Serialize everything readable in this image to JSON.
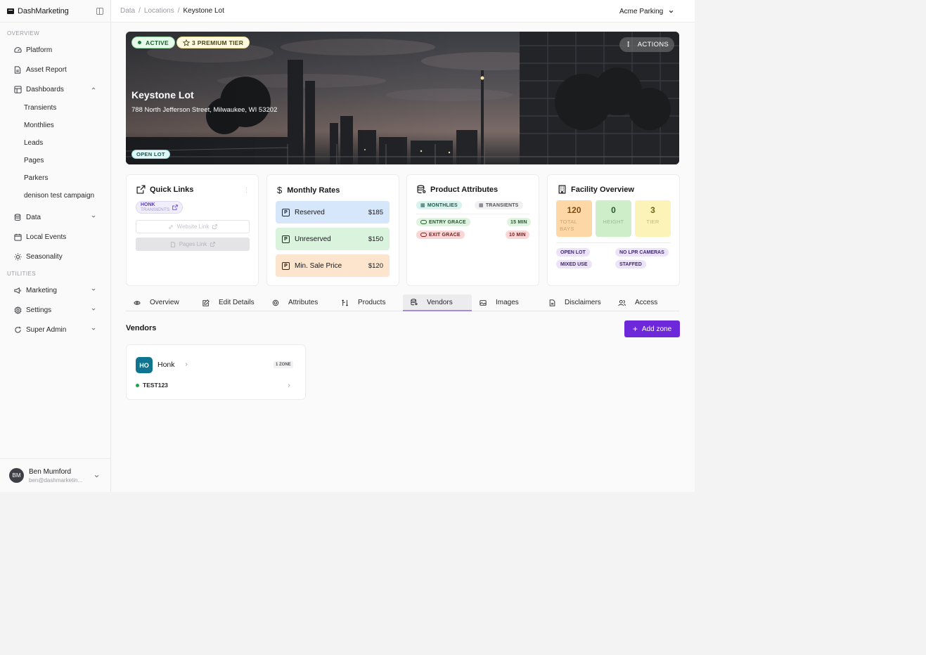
{
  "brand": {
    "name": "DashMarketing"
  },
  "sidebar": {
    "overview_label": "OVERVIEW",
    "utilities_label": "UTILITIES",
    "items": [
      {
        "label": "Platform",
        "icon": "gauge-icon"
      },
      {
        "label": "Asset Report",
        "icon": "file-icon"
      },
      {
        "label": "Dashboards",
        "icon": "layout-icon"
      }
    ],
    "dashboards": [
      "Transients",
      "Monthlies",
      "Leads",
      "Pages",
      "Parkers",
      "denison test campaign"
    ],
    "items2": [
      {
        "label": "Data",
        "icon": "database-icon"
      },
      {
        "label": "Local Events",
        "icon": "calendar-icon"
      },
      {
        "label": "Seasonality",
        "icon": "sun-icon"
      }
    ],
    "utilities": [
      {
        "label": "Marketing",
        "icon": "megaphone-icon"
      },
      {
        "label": "Settings",
        "icon": "gear-icon"
      },
      {
        "label": "Super Admin",
        "icon": "refresh-icon"
      }
    ]
  },
  "user": {
    "initials": "BM",
    "name": "Ben Mumford",
    "email": "ben@dashmarketin..."
  },
  "header": {
    "breadcrumb": [
      "Data",
      "Locations",
      "Keystone Lot"
    ],
    "org": "Acme Parking"
  },
  "hero": {
    "status": "ACTIVE",
    "tier": "3 PREMIUM TIER",
    "actions": "ACTIONS",
    "title": "Keystone Lot",
    "address": "788 North Jefferson Street, Milwaukee, WI 53202",
    "lot_type": "OPEN LOT"
  },
  "quick_links": {
    "title": "Quick Links",
    "chip_name": "HONK",
    "chip_sub": "TRANSIENTS",
    "website": "Website Link",
    "pages": "Pages Link"
  },
  "monthly_rates": {
    "title": "Monthly Rates",
    "rows": [
      {
        "label": "Reserved",
        "amount": "$185"
      },
      {
        "label": "Unreserved",
        "amount": "$150"
      },
      {
        "label": "Min. Sale Price",
        "amount": "$120"
      }
    ]
  },
  "product_attributes": {
    "title": "Product Attributes",
    "monthlies": "MONTHLIES",
    "transients": "TRANSIENTS",
    "entry_grace": "ENTRY GRACE",
    "entry_value": "15 MIN",
    "exit_grace": "EXIT GRACE",
    "exit_value": "10 MIN"
  },
  "facility": {
    "title": "Facility Overview",
    "stats": [
      {
        "value": "120",
        "label": "TOTAL BAYS"
      },
      {
        "value": "0",
        "label": "HEIGHT"
      },
      {
        "value": "3",
        "label": "TIER"
      }
    ],
    "tags": [
      "OPEN LOT",
      "NO LPR CAMERAS",
      "MIXED USE",
      "STAFFED"
    ]
  },
  "tabs": [
    "Overview",
    "Edit Details",
    "Attributes",
    "Products",
    "Vendors",
    "Images",
    "Disclaimers",
    "Access"
  ],
  "vendors": {
    "title": "Vendors",
    "add_button": "Add zone",
    "card": {
      "initials": "HO",
      "name": "Honk",
      "zones": "1 ZONE",
      "code": "TEST123"
    }
  },
  "colors": {
    "accent": "#6d28d9",
    "vendor_avatar": "#0e7490"
  }
}
